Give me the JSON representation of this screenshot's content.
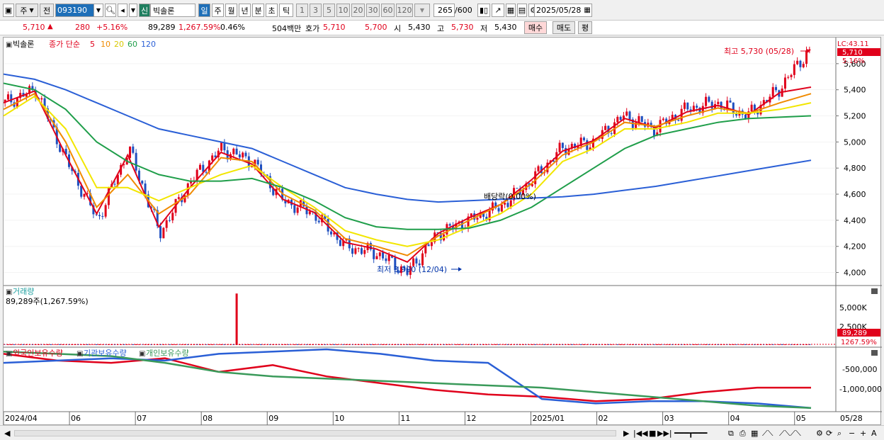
{
  "toolbar": {
    "period_label": "주",
    "prev_label": "전",
    "stock_code": "093190",
    "market_badge": "신",
    "stock_name": "빅솔론",
    "timeframes": [
      "일",
      "주",
      "월",
      "년",
      "분",
      "초",
      "틱"
    ],
    "minute_intervals": [
      "1",
      "3",
      "5",
      "10",
      "20",
      "30",
      "60",
      "120"
    ],
    "count": "265",
    "count_max": "/600",
    "date": "2025/05/28"
  },
  "quote": {
    "price": "5,710",
    "change_arrow": "▲",
    "change": "280",
    "change_pct": "+5.16%",
    "volume": "89,289",
    "volume_pct": "1,267.59%",
    "turnover_pct": "0.46%",
    "amount": "504백만",
    "hoga_label": "호가",
    "ask": "5,710",
    "bid": "5,700",
    "open_label": "시",
    "open": "5,430",
    "high_label": "고",
    "high": "5,730",
    "low_label": "저",
    "low": "5,430",
    "buy_label": "매수",
    "sell_label": "매도",
    "eval_label": "평"
  },
  "panels": {
    "price": {
      "stock_label": "빅솔론",
      "ma_title": "종가 단순",
      "ma_periods": [
        "5",
        "10",
        "20",
        "60",
        "120"
      ],
      "lc_label": "LC:43.11",
      "last_price_tag": "5,710",
      "last_pct_tag": "5.16%",
      "high_annotation": "최고 5,730 (05/28)",
      "low_annotation": "최저 3,990 (12/04)",
      "dividend_annotation": "배당락(0.00%)",
      "y_ticks": [
        "5,600",
        "5,400",
        "5,200",
        "5,000",
        "4,800",
        "4,600",
        "4,400",
        "4,200",
        "4,000"
      ]
    },
    "volume": {
      "title": "거래량",
      "readout": "89,289주(1,267.59%)",
      "y_ticks": [
        "5,000K",
        "2,500K"
      ],
      "last_tag": "89,289",
      "last_pct_tag": "1267.59%"
    },
    "holdings": {
      "series_labels": [
        "외국인보유수량",
        "기관보유수량",
        "개인보유수량"
      ],
      "y_ticks": [
        "-500,000",
        "-1,000,000"
      ]
    }
  },
  "x_axis": {
    "labels": [
      "2024/04",
      "06",
      "07",
      "08",
      "09",
      "10",
      "11",
      "12",
      "2025/01",
      "02",
      "03",
      "04",
      "05"
    ],
    "end_label": "05/28"
  },
  "colors": {
    "up": "#e0001b",
    "down": "#1f4fbf",
    "ma5": "#e0001b",
    "ma10": "#f08a00",
    "ma20": "#f2e600",
    "ma60": "#1f9e4a",
    "ma120": "#2a5fd6",
    "foreign": "#e0001b",
    "institution": "#2a5fd6",
    "individual": "#3a9a5a"
  },
  "chart_data": {
    "type": "candlestick",
    "x": [
      "2024/04",
      "06",
      "07",
      "08",
      "09",
      "10",
      "11",
      "12",
      "2025/01",
      "02",
      "03",
      "04",
      "05",
      "05/28"
    ],
    "close": [
      5300,
      5400,
      4850,
      4400,
      4950,
      4300,
      4700,
      4950,
      4850,
      4550,
      4450,
      4200,
      4150,
      4000,
      4300,
      4400,
      4500,
      4700,
      4950,
      5000,
      5200,
      5100,
      5250,
      5300,
      5200,
      5400,
      5710
    ],
    "ylim": [
      3900,
      5800
    ],
    "last": 5710,
    "high": {
      "value": 5730,
      "date": "05/28"
    },
    "low": {
      "value": 3990,
      "date": "12/04"
    },
    "series": [
      {
        "name": "5",
        "values": [
          5300,
          5390,
          4900,
          4450,
          4900,
          4350,
          4650,
          4920,
          4830,
          4560,
          4460,
          4230,
          4180,
          4080,
          4300,
          4420,
          4520,
          4710,
          4930,
          5010,
          5180,
          5110,
          5230,
          5280,
          5210,
          5380,
          5420
        ]
      },
      {
        "name": "10",
        "values": [
          5250,
          5370,
          5000,
          4500,
          4750,
          4450,
          4600,
          4880,
          4850,
          4600,
          4480,
          4260,
          4200,
          4130,
          4280,
          4400,
          4520,
          4680,
          4900,
          5000,
          5150,
          5120,
          5200,
          5260,
          5220,
          5300,
          5370
        ]
      },
      {
        "name": "20",
        "values": [
          5200,
          5350,
          5100,
          4650,
          4650,
          4550,
          4650,
          4750,
          4820,
          4650,
          4500,
          4320,
          4250,
          4200,
          4250,
          4350,
          4450,
          4600,
          4850,
          4950,
          5100,
          5100,
          5150,
          5220,
          5220,
          5250,
          5300
        ]
      },
      {
        "name": "60",
        "values": [
          5450,
          5400,
          5250,
          5000,
          4850,
          4750,
          4700,
          4700,
          4720,
          4650,
          4550,
          4420,
          4350,
          4330,
          4330,
          4340,
          4400,
          4500,
          4650,
          4800,
          4950,
          5050,
          5100,
          5150,
          5180,
          5190,
          5200
        ]
      },
      {
        "name": "120",
        "values": [
          5520,
          5480,
          5400,
          5300,
          5200,
          5100,
          5050,
          5000,
          4950,
          4850,
          4750,
          4650,
          4600,
          4560,
          4540,
          4550,
          4560,
          4570,
          4580,
          4600,
          4630,
          4660,
          4700,
          4740,
          4780,
          4820,
          4860
        ]
      }
    ],
    "volume": {
      "last": 89289,
      "spike_value": 5500000,
      "ylim": [
        0,
        6200000
      ]
    },
    "holdings": [
      {
        "name": "외국인보유수량",
        "values": [
          -200000,
          -350000,
          -400000,
          -300000,
          -600000,
          -450000,
          -700000,
          -850000,
          -1000000,
          -1100000,
          -1150000,
          -1250000,
          -1200000,
          -1050000,
          -950000,
          -950000
        ]
      },
      {
        "name": "기관보유수량",
        "values": [
          -400000,
          -350000,
          -300000,
          -350000,
          -200000,
          -150000,
          -100000,
          -200000,
          -350000,
          -400000,
          -1200000,
          -1300000,
          -1250000,
          -1250000,
          -1300000,
          -1400000
        ]
      },
      {
        "name": "개인보유수량",
        "values": [
          -150000,
          -200000,
          -250000,
          -400000,
          -600000,
          -700000,
          -750000,
          -800000,
          -850000,
          -900000,
          -950000,
          -1050000,
          -1150000,
          -1250000,
          -1350000,
          -1400000
        ]
      }
    ],
    "holdings_ylim": [
      -1450000,
      -100000
    ]
  }
}
